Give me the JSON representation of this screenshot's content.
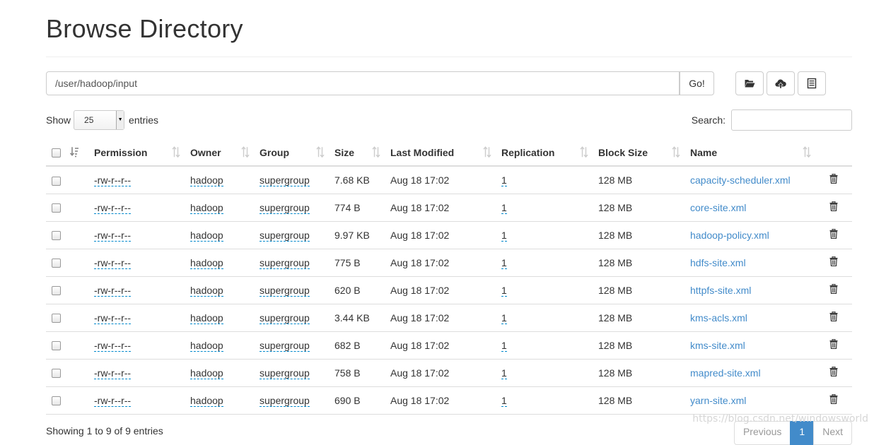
{
  "title": "Browse Directory",
  "path": {
    "value": "/user/hadoop/input",
    "go_label": "Go!"
  },
  "toolbar": {
    "icons": [
      "folder-open-icon",
      "cloud-upload-icon",
      "list-icon"
    ]
  },
  "show": {
    "prefix": "Show",
    "selected": "25",
    "suffix": "entries"
  },
  "search": {
    "label": "Search:"
  },
  "columns": [
    "Permission",
    "Owner",
    "Group",
    "Size",
    "Last Modified",
    "Replication",
    "Block Size",
    "Name"
  ],
  "rows": [
    {
      "permission": "-rw-r--r--",
      "owner": "hadoop",
      "group": "supergroup",
      "size": "7.68 KB",
      "modified": "Aug 18 17:02",
      "replication": "1",
      "block_size": "128 MB",
      "name": "capacity-scheduler.xml"
    },
    {
      "permission": "-rw-r--r--",
      "owner": "hadoop",
      "group": "supergroup",
      "size": "774 B",
      "modified": "Aug 18 17:02",
      "replication": "1",
      "block_size": "128 MB",
      "name": "core-site.xml"
    },
    {
      "permission": "-rw-r--r--",
      "owner": "hadoop",
      "group": "supergroup",
      "size": "9.97 KB",
      "modified": "Aug 18 17:02",
      "replication": "1",
      "block_size": "128 MB",
      "name": "hadoop-policy.xml"
    },
    {
      "permission": "-rw-r--r--",
      "owner": "hadoop",
      "group": "supergroup",
      "size": "775 B",
      "modified": "Aug 18 17:02",
      "replication": "1",
      "block_size": "128 MB",
      "name": "hdfs-site.xml"
    },
    {
      "permission": "-rw-r--r--",
      "owner": "hadoop",
      "group": "supergroup",
      "size": "620 B",
      "modified": "Aug 18 17:02",
      "replication": "1",
      "block_size": "128 MB",
      "name": "httpfs-site.xml"
    },
    {
      "permission": "-rw-r--r--",
      "owner": "hadoop",
      "group": "supergroup",
      "size": "3.44 KB",
      "modified": "Aug 18 17:02",
      "replication": "1",
      "block_size": "128 MB",
      "name": "kms-acls.xml"
    },
    {
      "permission": "-rw-r--r--",
      "owner": "hadoop",
      "group": "supergroup",
      "size": "682 B",
      "modified": "Aug 18 17:02",
      "replication": "1",
      "block_size": "128 MB",
      "name": "kms-site.xml"
    },
    {
      "permission": "-rw-r--r--",
      "owner": "hadoop",
      "group": "supergroup",
      "size": "758 B",
      "modified": "Aug 18 17:02",
      "replication": "1",
      "block_size": "128 MB",
      "name": "mapred-site.xml"
    },
    {
      "permission": "-rw-r--r--",
      "owner": "hadoop",
      "group": "supergroup",
      "size": "690 B",
      "modified": "Aug 18 17:02",
      "replication": "1",
      "block_size": "128 MB",
      "name": "yarn-site.xml"
    }
  ],
  "footer": {
    "info": "Showing 1 to 9 of 9 entries"
  },
  "pagination": {
    "previous": "Previous",
    "current": "1",
    "next": "Next"
  },
  "watermark": "https://blog.csdn.net/windowsworld",
  "colors": {
    "link": "#428bca",
    "border": "#dddddd",
    "active_page": "#428bca"
  }
}
